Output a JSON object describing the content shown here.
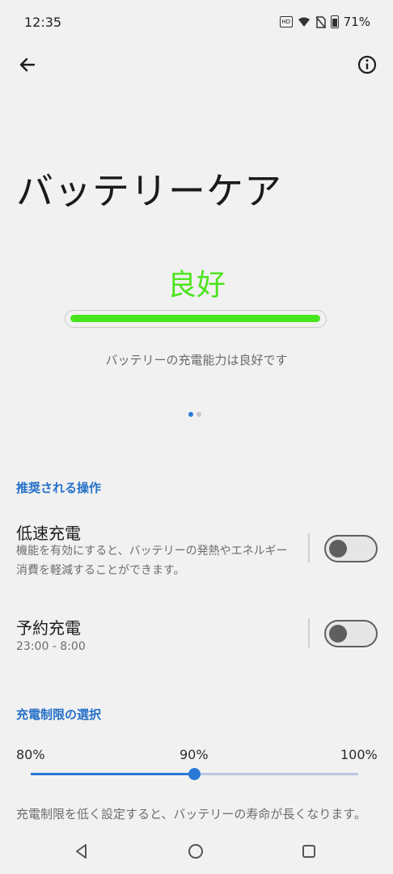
{
  "status_bar": {
    "time": "12:35",
    "battery_percent": "71%"
  },
  "screen": {
    "title": "バッテリーケア",
    "health": {
      "label": "良好",
      "description": "バッテリーの充電能力は良好です",
      "level_fraction": 1.0,
      "color": "#46e51c"
    },
    "pager": {
      "pages": 2,
      "active": 0
    }
  },
  "recommended": {
    "header": "推奨される操作",
    "items": [
      {
        "title": "低速充電",
        "subtitle": "機能を有効にすると、バッテリーの発熱やエネルギー消費を軽減することができます。",
        "enabled": false
      },
      {
        "title": "予約充電",
        "subtitle": "23:00 - 8:00",
        "enabled": false
      }
    ]
  },
  "charge_limit": {
    "header": "充電制限の選択",
    "labels": [
      "80%",
      "90%",
      "100%"
    ],
    "selected_index": 1,
    "description": "充電制限を低く設定すると、バッテリーの寿命が長くなります。"
  },
  "colors": {
    "accent": "#2a78d6",
    "good": "#4ee31e",
    "background": "#f1f1f1"
  },
  "icons": {
    "back": "back-arrow-icon",
    "info": "info-icon"
  }
}
